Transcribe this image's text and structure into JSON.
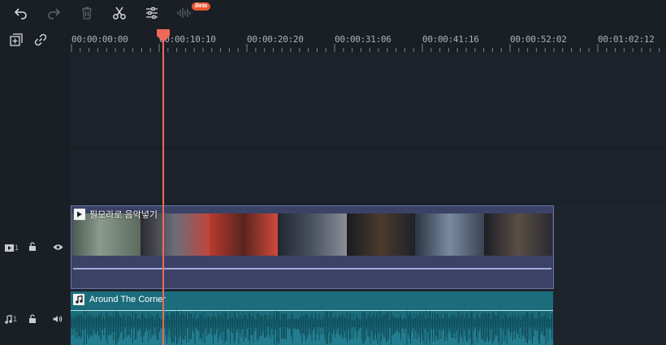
{
  "toolbar": {
    "undo_icon": "undo-icon",
    "redo_icon": "redo-icon",
    "delete_icon": "trash-icon",
    "cut_icon": "scissors-icon",
    "adjust_icon": "sliders-icon",
    "audio_icon": "waveform-icon",
    "beta_label": "Beta"
  },
  "ruler": {
    "labels": [
      "00:00:00:00",
      "00:00:10:10",
      "00:00:20:20",
      "00:00:31:06",
      "00:00:41:16",
      "00:00:52:02",
      "00:01:02:12"
    ]
  },
  "video_track": {
    "number": "1",
    "clip_title": "필모라로 음악넣기"
  },
  "audio_track": {
    "number": "1",
    "clip_title": "Around The Corner"
  },
  "colors": {
    "playhead": "#f0685a",
    "video_clip": "#3b4266",
    "audio_clip": "#1b6d7c",
    "beta_badge": "#e8572f"
  }
}
